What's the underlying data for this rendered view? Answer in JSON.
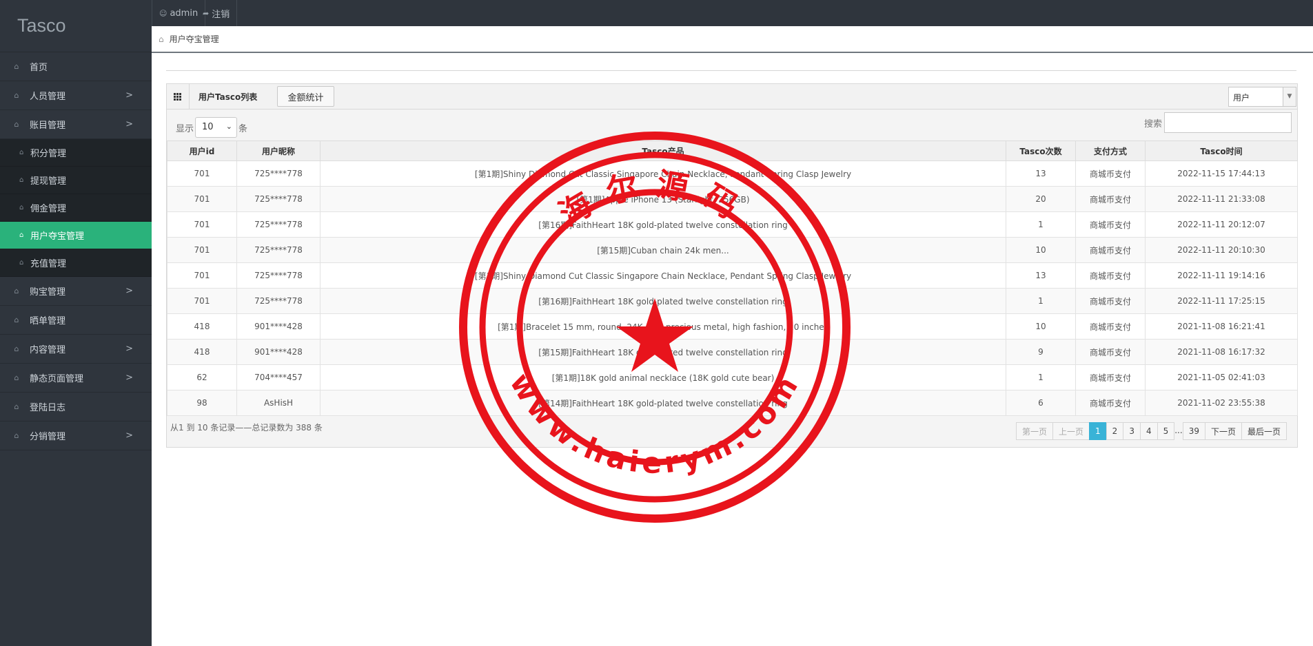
{
  "app": {
    "brand": "Tasco"
  },
  "topbar": {
    "user": "admin",
    "logout": "注销"
  },
  "sidebar": {
    "items": [
      {
        "label": "首页",
        "expandable": false
      },
      {
        "label": "人员管理",
        "expandable": true
      },
      {
        "label": "账目管理",
        "expandable": true
      },
      {
        "label": "积分管理",
        "sub": true
      },
      {
        "label": "提现管理",
        "sub": true
      },
      {
        "label": "佣金管理",
        "sub": true
      },
      {
        "label": "用户夺宝管理",
        "sub": true,
        "active": true
      },
      {
        "label": "充值管理",
        "sub": true
      },
      {
        "label": "购宝管理",
        "expandable": true
      },
      {
        "label": "晒单管理",
        "expandable": false
      },
      {
        "label": "内容管理",
        "expandable": true
      },
      {
        "label": "静态页面管理",
        "expandable": true
      },
      {
        "label": "登陆日志",
        "expandable": false
      },
      {
        "label": "分销管理",
        "expandable": true
      }
    ],
    "chevron": ">"
  },
  "breadcrumb": {
    "title": "用户夺宝管理"
  },
  "panel": {
    "title": "用户Tasco列表",
    "stat_button": "金额统计",
    "filter_select": "用户",
    "show_label": "显示",
    "page_length": "10",
    "entries_label": "条",
    "search_label": "搜索",
    "search_value": ""
  },
  "table": {
    "headers": [
      "用户id",
      "用户昵称",
      "Tasco产品",
      "Tasco次数",
      "支付方式",
      "Tasco时间"
    ],
    "rows": [
      [
        "701",
        "725****778",
        "[第1期]Shiny Diamond Cut Classic Singapore Chain Necklace, Pendant Spring Clasp Jewelry",
        "13",
        "商城币支付",
        "2022-11-15 17:44:13"
      ],
      [
        "701",
        "725****778",
        "[第1期]Apple iPhone 13 (Starlight, 256GB)",
        "20",
        "商城币支付",
        "2022-11-11 21:33:08"
      ],
      [
        "701",
        "725****778",
        "[第16期]FaithHeart 18K gold-plated twelve constellation ring",
        "1",
        "商城币支付",
        "2022-11-11 20:12:07"
      ],
      [
        "701",
        "725****778",
        "[第15期]Cuban chain 24k men...",
        "10",
        "商城币支付",
        "2022-11-11 20:10:30"
      ],
      [
        "701",
        "725****778",
        "[第1期]Shiny Diamond Cut Classic Singapore Chain Necklace, Pendant Spring Clasp Jewelry",
        "13",
        "商城币支付",
        "2022-11-11 19:14:16"
      ],
      [
        "701",
        "725****778",
        "[第16期]FaithHeart 18K gold-plated twelve constellation ring",
        "1",
        "商城币支付",
        "2022-11-11 17:25:15"
      ],
      [
        "418",
        "901****428",
        "[第1期]Bracelet 15 mm, round, 24K gold precious metal, high fashion, 20 inches",
        "10",
        "商城币支付",
        "2021-11-08 16:21:41"
      ],
      [
        "418",
        "901****428",
        "[第15期]FaithHeart 18K gold-plated twelve constellation ring",
        "9",
        "商城币支付",
        "2021-11-08 16:17:32"
      ],
      [
        "62",
        "704****457",
        "[第1期]18K gold animal necklace (18K gold cute bear)",
        "1",
        "商城币支付",
        "2021-11-05 02:41:03"
      ],
      [
        "98",
        "AsHisH",
        "[第14期]FaithHeart 18K gold-plated twelve constellation ring",
        "6",
        "商城币支付",
        "2021-11-02 23:55:38"
      ]
    ]
  },
  "footer": {
    "info": "从1 到 10 条记录——总记录数为 388 条"
  },
  "pager": {
    "first": "第一页",
    "prev": "上一页",
    "pages": [
      "1",
      "2",
      "3",
      "4",
      "5"
    ],
    "ellipsis": "...",
    "last_page": "39",
    "next": "下一页",
    "last": "最后一页",
    "current": "1"
  },
  "watermark": {
    "top_text": "海尔源码",
    "bottom_text": "www.haierym.com",
    "color": "#e8141c"
  },
  "colors": {
    "sidebar_bg": "#2f353d",
    "active": "#2ab27b",
    "pager_current": "#39b3d7"
  }
}
